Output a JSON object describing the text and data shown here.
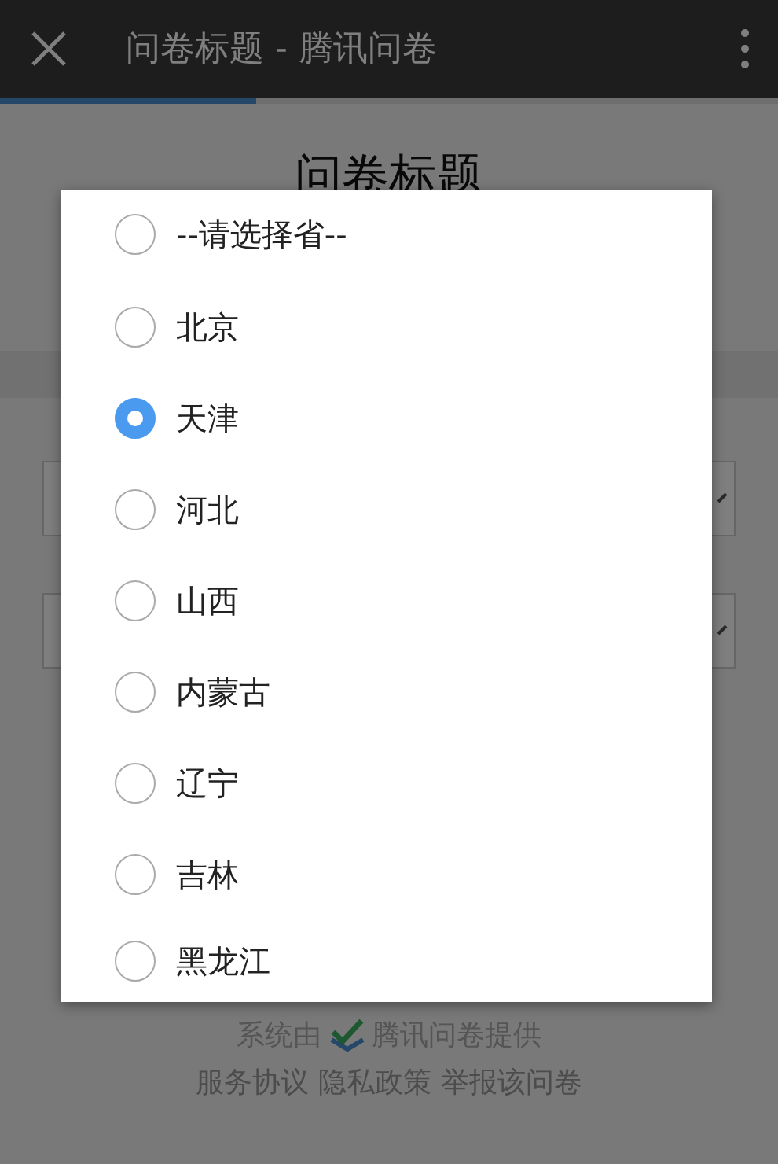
{
  "app_bar": {
    "title": "问卷标题 - 腾讯问卷"
  },
  "progress": {
    "level": 0.33
  },
  "page": {
    "title": "问卷标题",
    "fields": [
      {
        "kind": "select"
      },
      {
        "kind": "select"
      }
    ]
  },
  "footer": {
    "credit_prefix": "系统由",
    "credit_brand": "腾讯问卷提供",
    "links": [
      "服务协议",
      "隐私政策",
      "举报该问卷"
    ]
  },
  "picker": {
    "options": [
      {
        "label": "--请选择省--",
        "selected": false
      },
      {
        "label": "北京",
        "selected": false
      },
      {
        "label": "天津",
        "selected": true
      },
      {
        "label": "河北",
        "selected": false
      },
      {
        "label": "山西",
        "selected": false
      },
      {
        "label": "内蒙古",
        "selected": false
      },
      {
        "label": "辽宁",
        "selected": false
      },
      {
        "label": "吉林",
        "selected": false
      },
      {
        "label": "黑龙江",
        "selected": false
      }
    ]
  }
}
